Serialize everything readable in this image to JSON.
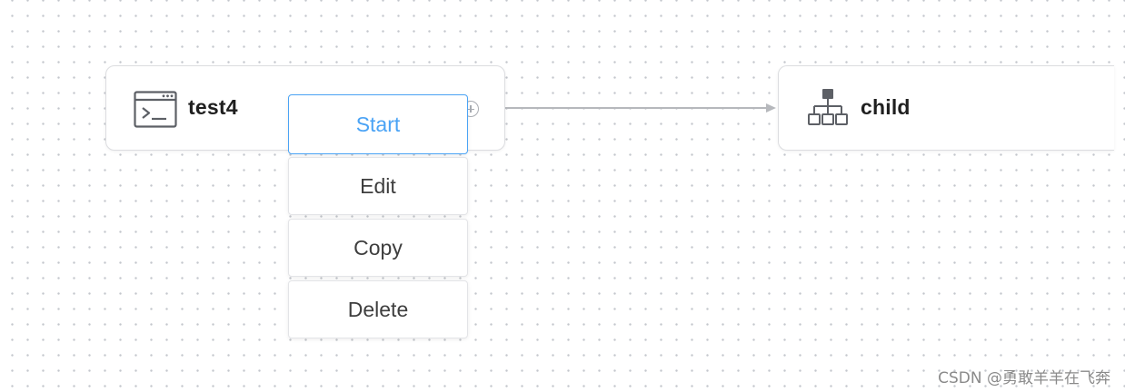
{
  "canvas": {
    "dot_color": "#c4c7cd",
    "background": "#ffffff"
  },
  "nodes": [
    {
      "label": "test4",
      "icon": "terminal-icon"
    },
    {
      "label": "child",
      "icon": "sitemap-icon"
    }
  ],
  "context_menu": {
    "items": [
      "Start",
      "Edit",
      "Copy",
      "Delete"
    ],
    "active_color": "#4aa3f5"
  },
  "watermark": "CSDN @勇敢羊羊在飞奔"
}
